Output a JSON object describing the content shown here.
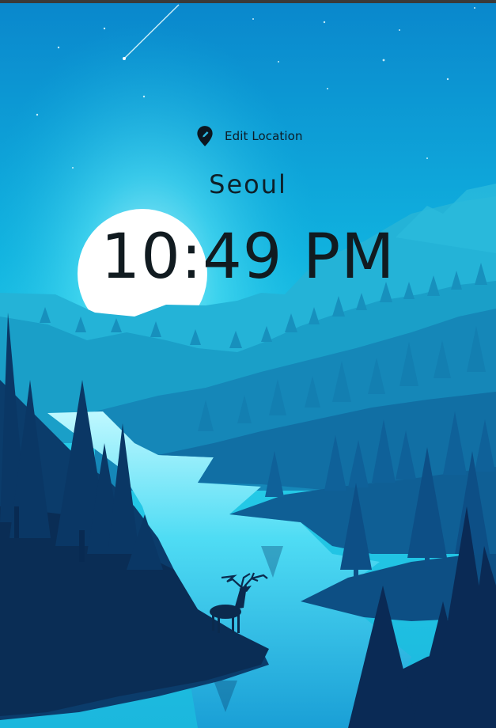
{
  "app": {
    "edit_location_label": "Edit Location",
    "city": "Seoul",
    "time": "10:49 PM"
  },
  "icons": {
    "location": "location-pin-icon"
  },
  "colors": {
    "sky_top": "#0a8fd0",
    "sky_bottom": "#1ec8e8",
    "sun": "#ffffff",
    "dark_forest": "#0b2a4f",
    "text": "#111b20"
  }
}
